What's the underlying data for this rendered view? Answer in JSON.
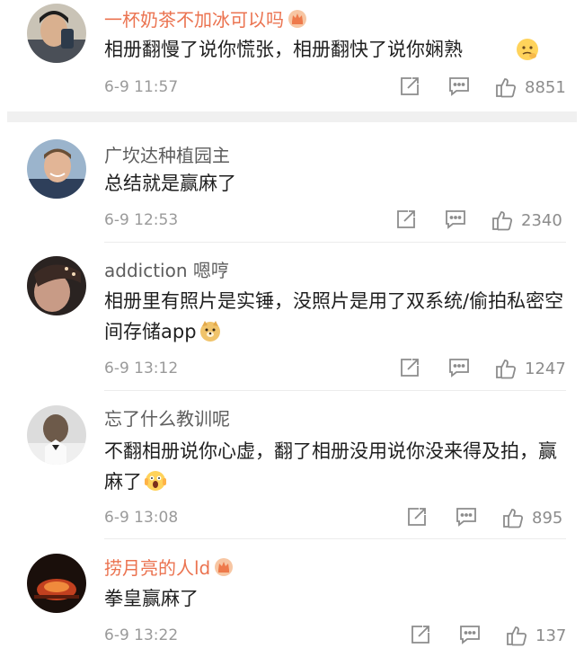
{
  "comments": [
    {
      "user": "一杯奶茶不加冰可以吗",
      "text": "相册翻慢了说你慌张，相册翻快了说你娴熟",
      "time": "6-9 11:57",
      "likes": "8851"
    },
    {
      "user": "广坎达种植园主",
      "text": "总结就是赢麻了",
      "time": "6-9 12:53",
      "likes": "2340"
    },
    {
      "user": "addiction 嗯哼",
      "text": "相册里有照片是实锤，没照片是用了双系统/偷拍私密空间存储app",
      "time": "6-9 13:12",
      "likes": "1247"
    },
    {
      "user": "忘了什么教训呢",
      "text": "不翻相册说你心虚，翻了相册没用说你没来得及拍，赢麻了",
      "time": "6-9 13:08",
      "likes": "895"
    },
    {
      "user": "捞月亮的人ld",
      "text": "拳皇赢麻了",
      "time": "6-9 13:22",
      "likes": "137"
    }
  ],
  "colors": {
    "vip_name": "#eb7350",
    "normal_name": "#5d5d5d",
    "meta_text": "#9a9a9a",
    "body_text": "#1f1f1f"
  },
  "icons": {
    "badge": "vip-crown-badge-icon",
    "repost": "repost-icon",
    "reply": "comment-icon",
    "like": "thumbs-up-icon"
  }
}
